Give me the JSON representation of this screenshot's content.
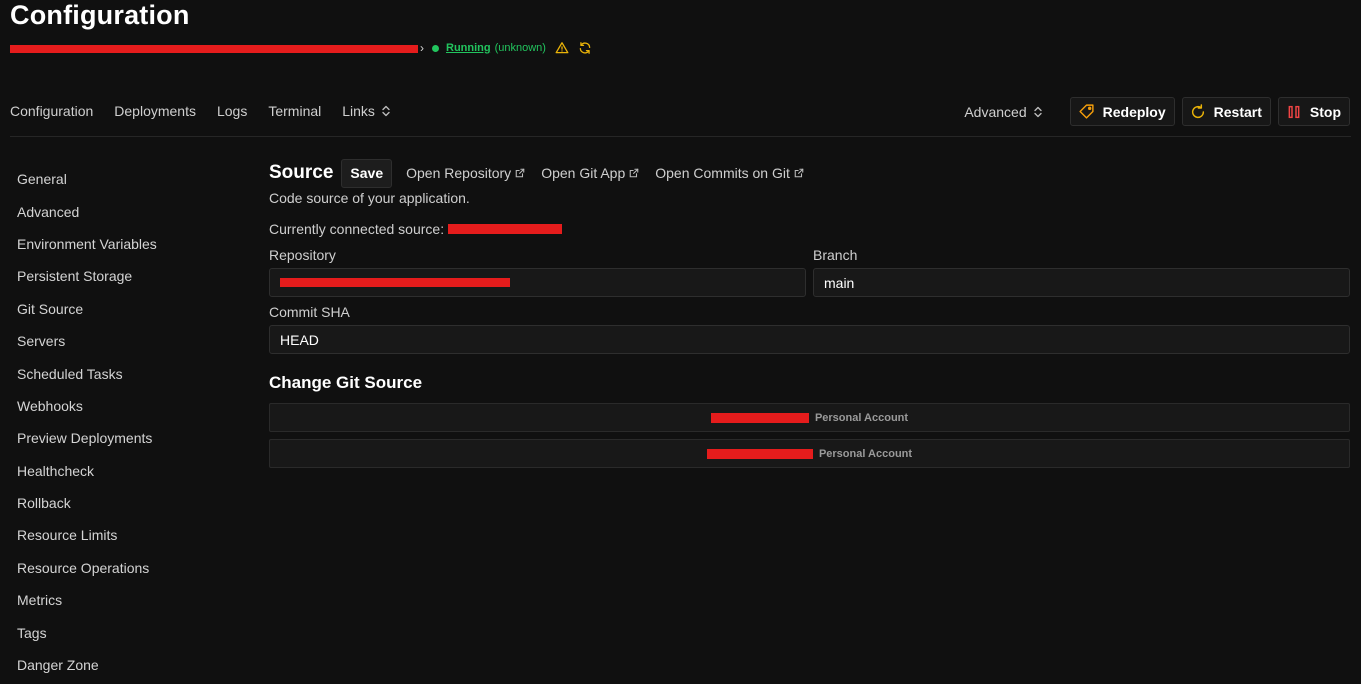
{
  "header": {
    "title": "Configuration",
    "status": "Running",
    "status_detail": "(unknown)",
    "chevron": "›"
  },
  "nav": {
    "tabs": [
      "Configuration",
      "Deployments",
      "Logs",
      "Terminal",
      "Links"
    ],
    "advanced": "Advanced",
    "redeploy": "Redeploy",
    "restart": "Restart",
    "stop": "Stop"
  },
  "sidebar": {
    "items": [
      "General",
      "Advanced",
      "Environment Variables",
      "Persistent Storage",
      "Git Source",
      "Servers",
      "Scheduled Tasks",
      "Webhooks",
      "Preview Deployments",
      "Healthcheck",
      "Rollback",
      "Resource Limits",
      "Resource Operations",
      "Metrics",
      "Tags",
      "Danger Zone"
    ]
  },
  "source": {
    "title": "Source",
    "save": "Save",
    "open_repository": "Open Repository",
    "open_git_app": "Open Git App",
    "open_commits": "Open Commits on Git",
    "subtitle": "Code source of your application.",
    "connected_label": "Currently connected source:",
    "repository_label": "Repository",
    "branch_label": "Branch",
    "branch_value": "main",
    "commit_label": "Commit SHA",
    "commit_value": "HEAD"
  },
  "change_git": {
    "title": "Change Git Source",
    "accounts": [
      {
        "type": "Personal Account"
      },
      {
        "type": "Personal Account"
      }
    ]
  },
  "colors": {
    "status_green": "#22c55e",
    "warning_yellow": "#eab308",
    "redeploy_orange": "#f59e0b",
    "stop_red": "#ef4444"
  }
}
